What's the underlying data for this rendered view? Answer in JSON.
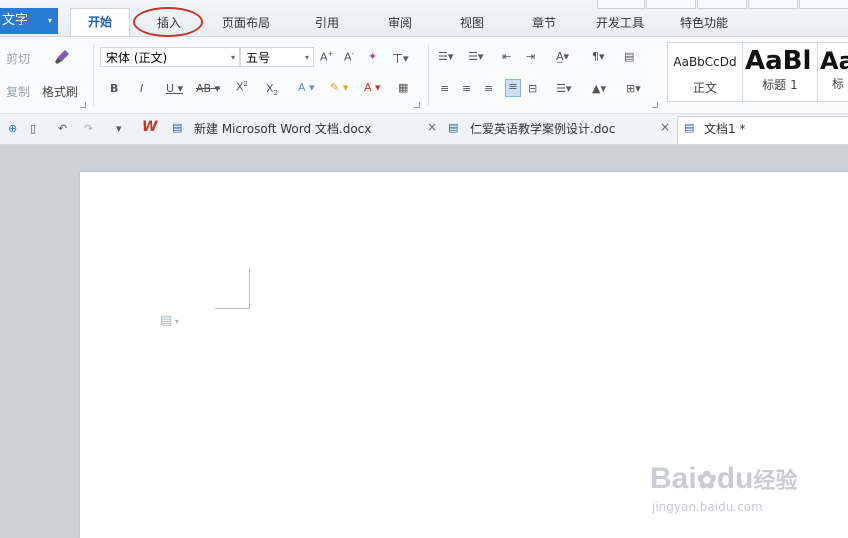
{
  "app_button": {
    "label": "文字",
    "arrow": "▾"
  },
  "menu_tabs": [
    "开始",
    "插入",
    "页面布局",
    "引用",
    "审阅",
    "视图",
    "章节",
    "开发工具",
    "特色功能"
  ],
  "ribbon": {
    "cut_label": "剪切",
    "copy_label": "复制",
    "format_painter_label": "格式刷",
    "font_name": "宋体 (正文)",
    "font_size": "五号",
    "styles": [
      {
        "preview": "AaBbCcDd",
        "name": "正文"
      },
      {
        "preview": "AaBl",
        "name": "标题 1"
      },
      {
        "preview": "Aa",
        "name": "标"
      }
    ]
  },
  "doc_tabs": [
    {
      "title": "新建 Microsoft Word 文档.docx",
      "close": "×"
    },
    {
      "title": "仁爱英语教学案例设计.doc",
      "close": "×"
    },
    {
      "title": "文档1 *"
    }
  ],
  "doc_brand": "W",
  "watermark": {
    "brand": "Bai",
    "brand2": "du",
    "brand_cn": "经验",
    "url": "jingyan.baidu.com"
  },
  "accent": "#2a7bd2",
  "highlight_color": "#c0392b"
}
